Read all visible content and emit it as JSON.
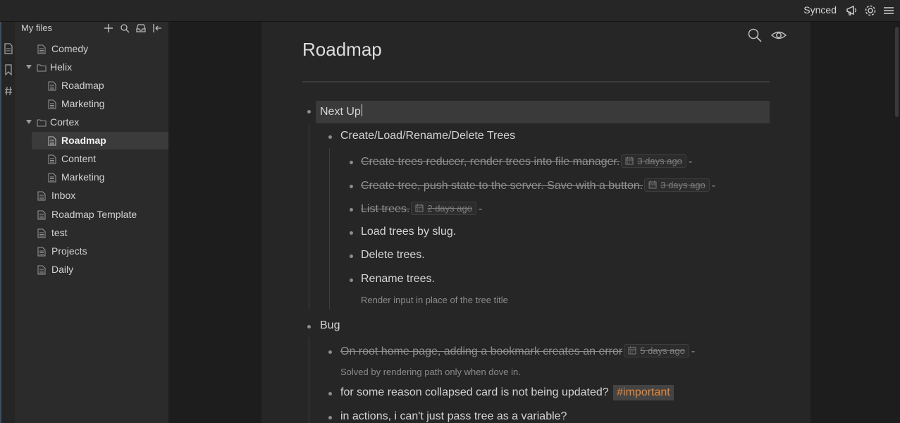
{
  "topbar": {
    "status": "Synced",
    "icons": [
      "megaphone-icon",
      "gear-icon",
      "hamburger-menu-icon"
    ]
  },
  "rail": {
    "icons": [
      "document-icon",
      "bookmark-icon",
      "hashtag-icon"
    ]
  },
  "sidebar": {
    "title": "My files",
    "actions": [
      "plus-icon",
      "search-icon",
      "inbox-icon",
      "collapse-sidebar-icon"
    ],
    "items": [
      {
        "label": "Comedy",
        "type": "file"
      },
      {
        "label": "Helix",
        "type": "folder"
      },
      {
        "label": "Roadmap",
        "type": "file"
      },
      {
        "label": "Marketing",
        "type": "file"
      },
      {
        "label": "Cortex",
        "type": "folder"
      },
      {
        "label": "Roadmap",
        "type": "file",
        "active": true
      },
      {
        "label": "Content",
        "type": "file"
      },
      {
        "label": "Marketing",
        "type": "file"
      },
      {
        "label": "Inbox",
        "type": "file"
      },
      {
        "label": "Roadmap Template",
        "type": "file"
      },
      {
        "label": "test",
        "type": "file"
      },
      {
        "label": "Projects",
        "type": "file"
      },
      {
        "label": "Daily",
        "type": "file"
      }
    ]
  },
  "document": {
    "title": "Roadmap",
    "icons": [
      "search-icon",
      "eye-icon"
    ],
    "nodes": {
      "next_up": "Next Up",
      "crud": "Create/Load/Rename/Delete Trees",
      "t1": {
        "text": "Create trees reducer, render trees into file manager.",
        "date": "3 days ago"
      },
      "t2": {
        "text": "Create tree, push state to the server. Save with a button.",
        "date": "3 days ago"
      },
      "t3": {
        "text": "List trees.",
        "date": "2 days ago"
      },
      "t4": "Load trees by slug.",
      "t5": "Delete trees.",
      "t6": "Rename trees.",
      "t6_note": "Render input in place of the tree title",
      "bug": "Bug",
      "b1": {
        "text": "On root home page, adding a bookmark creates an error",
        "date": "5 days ago"
      },
      "b1_note": "Solved by rendering path only when dove in.",
      "b2": {
        "text": "for some reason collapsed card is not being updated?",
        "tag": "#important"
      },
      "b3": "in actions, i can't just pass tree as a variable?",
      "dash": "-"
    }
  },
  "colors": {
    "tag": "#e6873a",
    "background": "#1c1c1c",
    "panel": "#262626"
  }
}
